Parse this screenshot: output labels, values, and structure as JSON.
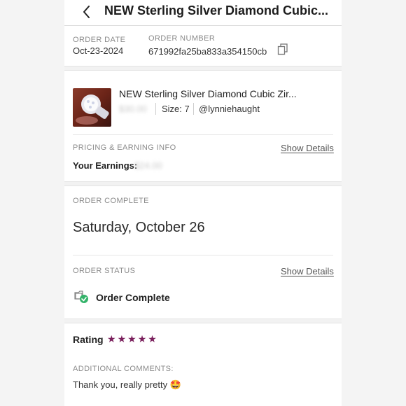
{
  "header": {
    "title": "NEW Sterling Silver Diamond Cubic..."
  },
  "order": {
    "date_label": "ORDER DATE",
    "date": "Oct-23-2024",
    "number_label": "ORDER NUMBER",
    "number": "671992fa25ba833a354150cb"
  },
  "item": {
    "title": "NEW Sterling Silver Diamond Cubic Zir...",
    "price": "$30.00",
    "size": "Size: 7",
    "seller": "@lynniehaught"
  },
  "pricing": {
    "label": "PRICING & EARNING INFO",
    "show_details": "Show Details",
    "earnings_label": "Your Earnings:",
    "earnings_value": "$24.00"
  },
  "complete": {
    "label": "ORDER COMPLETE",
    "date": "Saturday, October 26"
  },
  "status": {
    "label": "ORDER STATUS",
    "show_details": "Show Details",
    "value": "Order Complete"
  },
  "rating": {
    "label": "Rating",
    "stars": 5,
    "star_color": "#7a1f5c"
  },
  "comments": {
    "label": "ADDITIONAL COMMENTS:",
    "text": "Thank you, really pretty",
    "emoji": "🤩"
  },
  "icons": [
    "back-chevron-icon",
    "copy-icon",
    "order-complete-icon",
    "star-icon"
  ]
}
